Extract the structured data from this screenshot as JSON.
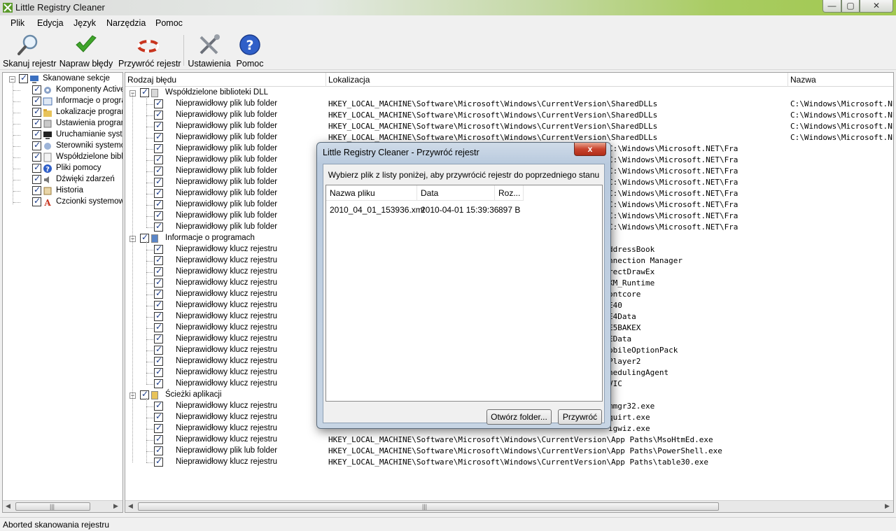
{
  "window": {
    "title": "Little Registry Cleaner",
    "minimize": "—",
    "maximize": "▢",
    "close": "✕"
  },
  "menu": [
    "Plik",
    "Edycja",
    "Język",
    "Narzędzia",
    "Pomoc"
  ],
  "toolbar": {
    "scan": "Skanuj rejestr",
    "fix": "Napraw błędy",
    "restore": "Przywróć rejestr",
    "settings": "Ustawienia",
    "help": "Pomoc"
  },
  "tree": {
    "root": "Skanowane sekcje",
    "items": [
      "Komponenty ActiveX",
      "Informacje o programach",
      "Lokalizacje programów",
      "Ustawienia programów",
      "Uruchamianie systemu",
      "Sterowniki systemowe",
      "Współdzielone biblioteki",
      "Pliki pomocy",
      "Dźwięki zdarzeń",
      "Historia",
      "Czcionki systemowe"
    ]
  },
  "grid": {
    "headers": {
      "type": "Rodzaj błędu",
      "location": "Lokalizacja",
      "name": "Nazwa"
    },
    "groups": [
      {
        "label": "Współdzielone biblioteki DLL",
        "rows": [
          {
            "type": "Nieprawidłowy plik lub folder",
            "location": "HKEY_LOCAL_MACHINE\\Software\\Microsoft\\Windows\\CurrentVersion\\SharedDLLs",
            "name": "C:\\Windows\\Microsoft.NET\\Fra"
          },
          {
            "type": "Nieprawidłowy plik lub folder",
            "location": "HKEY_LOCAL_MACHINE\\Software\\Microsoft\\Windows\\CurrentVersion\\SharedDLLs",
            "name": "C:\\Windows\\Microsoft.NET\\Fra"
          },
          {
            "type": "Nieprawidłowy plik lub folder",
            "location": "HKEY_LOCAL_MACHINE\\Software\\Microsoft\\Windows\\CurrentVersion\\SharedDLLs",
            "name": "C:\\Windows\\Microsoft.NET\\Fra"
          },
          {
            "type": "Nieprawidłowy plik lub folder",
            "location": "HKEY_LOCAL_MACHINE\\Software\\Microsoft\\Windows\\CurrentVersion\\SharedDLLs",
            "name": "C:\\Windows\\Microsoft.NET\\Fra"
          },
          {
            "type": "Nieprawidłowy plik lub folder",
            "location": "",
            "name": "C:\\Windows\\Microsoft.NET\\Fra"
          },
          {
            "type": "Nieprawidłowy plik lub folder",
            "location": "",
            "name": "C:\\Windows\\Microsoft.NET\\Fra"
          },
          {
            "type": "Nieprawidłowy plik lub folder",
            "location": "",
            "name": "C:\\Windows\\Microsoft.NET\\Fra"
          },
          {
            "type": "Nieprawidłowy plik lub folder",
            "location": "",
            "name": "C:\\Windows\\Microsoft.NET\\Fra"
          },
          {
            "type": "Nieprawidłowy plik lub folder",
            "location": "",
            "name": "C:\\Windows\\Microsoft.NET\\Fra"
          },
          {
            "type": "Nieprawidłowy plik lub folder",
            "location": "",
            "name": "C:\\Windows\\Microsoft.NET\\Fra"
          },
          {
            "type": "Nieprawidłowy plik lub folder",
            "location": "",
            "name": "C:\\Windows\\Microsoft.NET\\Fra"
          },
          {
            "type": "Nieprawidłowy plik lub folder",
            "location": "",
            "name": "C:\\Windows\\Microsoft.NET\\Fra"
          }
        ]
      },
      {
        "label": "Informacje o programach",
        "rows": [
          {
            "type": "Nieprawidłowy klucz rejestru",
            "location": "",
            "name": "ddressBook"
          },
          {
            "type": "Nieprawidłowy klucz rejestru",
            "location": "",
            "name": "nnection Manager"
          },
          {
            "type": "Nieprawidłowy klucz rejestru",
            "location": "",
            "name": "rectDrawEx"
          },
          {
            "type": "Nieprawidłowy klucz rejestru",
            "location": "",
            "name": "XM_Runtime"
          },
          {
            "type": "Nieprawidłowy klucz rejestru",
            "location": "",
            "name": "ontcore"
          },
          {
            "type": "Nieprawidłowy klucz rejestru",
            "location": "",
            "name": "E40"
          },
          {
            "type": "Nieprawidłowy klucz rejestru",
            "location": "",
            "name": "E4Data"
          },
          {
            "type": "Nieprawidłowy klucz rejestru",
            "location": "",
            "name": "E5BAKEX"
          },
          {
            "type": "Nieprawidłowy klucz rejestru",
            "location": "",
            "name": "EData"
          },
          {
            "type": "Nieprawidłowy klucz rejestru",
            "location": "",
            "name": "obileOptionPack"
          },
          {
            "type": "Nieprawidłowy klucz rejestru",
            "location": "",
            "name": "Player2"
          },
          {
            "type": "Nieprawidłowy klucz rejestru",
            "location": "",
            "name": "hedulingAgent"
          },
          {
            "type": "Nieprawidłowy klucz rejestru",
            "location": "",
            "name": "VIC"
          }
        ]
      },
      {
        "label": "Ścieżki aplikacji",
        "rows": [
          {
            "type": "Nieprawidłowy klucz rejestru",
            "location": "",
            "name": "mmgr32.exe"
          },
          {
            "type": "Nieprawidłowy klucz rejestru",
            "location": "",
            "name": "quirt.exe"
          },
          {
            "type": "Nieprawidłowy klucz rejestru",
            "location": "",
            "name": "igwiz.exe"
          },
          {
            "type": "Nieprawidłowy klucz rejestru",
            "location": "HKEY_LOCAL_MACHINE\\Software\\Microsoft\\Windows\\CurrentVersion\\App Paths\\MsoHtmEd.exe",
            "name": ""
          },
          {
            "type": "Nieprawidłowy plik lub folder",
            "location": "HKEY_LOCAL_MACHINE\\Software\\Microsoft\\Windows\\CurrentVersion\\App Paths\\PowerShell.exe",
            "name": ""
          },
          {
            "type": "Nieprawidłowy klucz rejestru",
            "location": "HKEY_LOCAL_MACHINE\\Software\\Microsoft\\Windows\\CurrentVersion\\App Paths\\table30.exe",
            "name": ""
          }
        ]
      }
    ]
  },
  "status": "Aborted skanowania rejestru",
  "dialog": {
    "title": "Little Registry Cleaner - Przywróć rejestr",
    "close": "x",
    "message": "Wybierz plik z listy poniżej, aby przywrócić rejestr do poprzedniego stanu",
    "columns": {
      "file": "Nazwa pliku",
      "date": "Data",
      "size": "Roz..."
    },
    "files": [
      {
        "file": "2010_04_01_153936.xml",
        "date": "2010-04-01 15:39:36",
        "size": "897 B"
      }
    ],
    "open_folder": "Otwórz folder...",
    "restore": "Przywróć"
  },
  "colors": {
    "accent_green": "#a0c84e",
    "check_blue": "#1b3c8a",
    "close_red": "#c9442e"
  }
}
